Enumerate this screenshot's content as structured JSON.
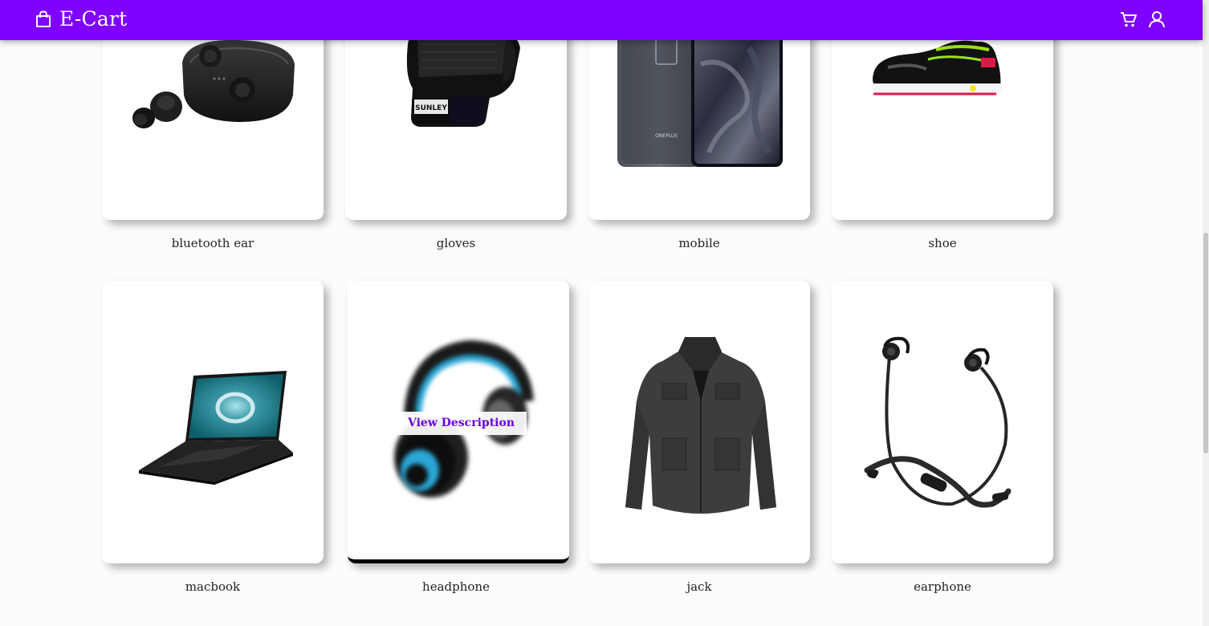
{
  "header": {
    "brand": "E-Cart",
    "bg_color": "#7f00ff",
    "icons": [
      "shopping-bag-icon",
      "cart-icon",
      "user-icon"
    ]
  },
  "products": [
    {
      "name": "bluetooth ear",
      "image": "wireless-earbuds-image"
    },
    {
      "name": "gloves",
      "image": "gloves-image"
    },
    {
      "name": "mobile",
      "image": "mobile-phone-image"
    },
    {
      "name": "shoe",
      "image": "sneaker-image"
    },
    {
      "name": "macbook",
      "image": "laptop-image"
    },
    {
      "name": "headphone",
      "image": "headphone-image"
    },
    {
      "name": "jack",
      "image": "jacket-image"
    },
    {
      "name": "earphone",
      "image": "neckband-earphone-image"
    }
  ],
  "hover_overlay": {
    "label": "View Description",
    "product": "headphone"
  }
}
